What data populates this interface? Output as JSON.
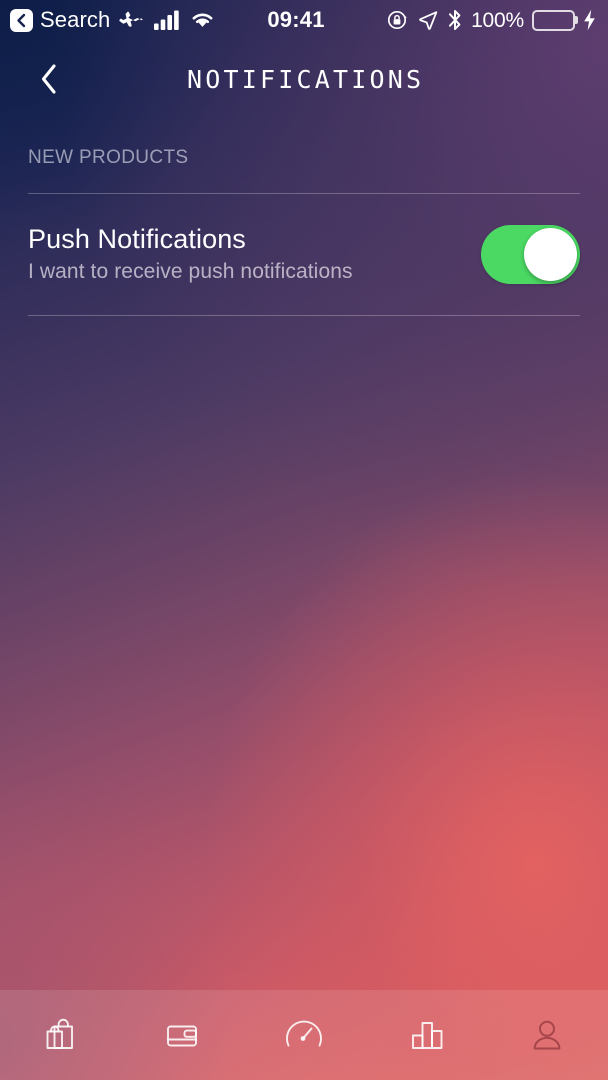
{
  "status_bar": {
    "back_icon": "chevron-left-icon",
    "back_app_label": "Search",
    "airplane_icon": "airplane-mode-icon",
    "signal_icon": "cellular-signal-icon",
    "wifi_icon": "wifi-icon",
    "time": "09:41",
    "rotation_lock_icon": "rotation-lock-icon",
    "location_icon": "location-arrow-icon",
    "bluetooth_icon": "bluetooth-icon",
    "battery_percent": "100%",
    "battery_icon": "battery-full-icon",
    "charging_icon": "charging-bolt-icon",
    "battery_color": "#4cd964"
  },
  "navbar": {
    "back_icon": "chevron-left-icon",
    "title": "NOTIFICATIONS"
  },
  "section": {
    "header": "NEW PRODUCTS"
  },
  "setting_row": {
    "title": "Push Notifications",
    "subtitle": "I want to receive push notifications",
    "toggle": {
      "name": "push-notifications-toggle",
      "state": "on",
      "on_color": "#4bd863",
      "knob_color": "#ffffff"
    }
  },
  "tab_bar": {
    "items": [
      {
        "icon": "shopping-bags-icon",
        "name": "tab-shop"
      },
      {
        "icon": "wallet-icon",
        "name": "tab-wallet"
      },
      {
        "icon": "speedometer-icon",
        "name": "tab-dashboard"
      },
      {
        "icon": "bar-chart-icon",
        "name": "tab-stats"
      },
      {
        "icon": "person-icon",
        "name": "tab-profile"
      }
    ]
  },
  "theme": {
    "gradient_top_left": "#10204c",
    "gradient_top_right": "#533a62",
    "gradient_bottom_left": "#a0546e",
    "gradient_bottom_right": "#d95b62",
    "accent_green": "#4bd863"
  }
}
